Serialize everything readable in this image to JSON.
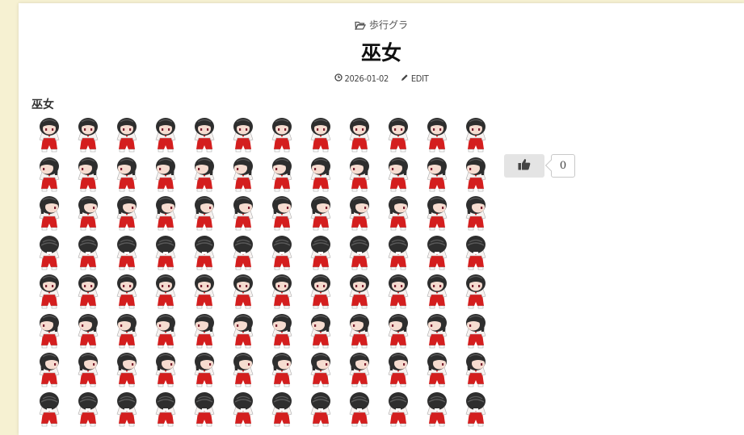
{
  "post": {
    "category": "歩行グラ",
    "title": "巫女",
    "date": "2026-01-02",
    "edit_label": "EDIT",
    "subheading": "巫女"
  },
  "sprite_sheet": {
    "columns": 12,
    "row_directions": [
      "down",
      "left",
      "right",
      "up",
      "down",
      "left",
      "right",
      "up"
    ],
    "colors": {
      "hair": "#2e2e2e",
      "hair_shine": "#5a5a5a",
      "skin": "#f6dcd0",
      "robe": "#f7f2f0",
      "hakama": "#d41e1e",
      "eyes": "#7a2030"
    }
  },
  "like": {
    "count": "0",
    "icon": "thumbs-up-icon"
  }
}
